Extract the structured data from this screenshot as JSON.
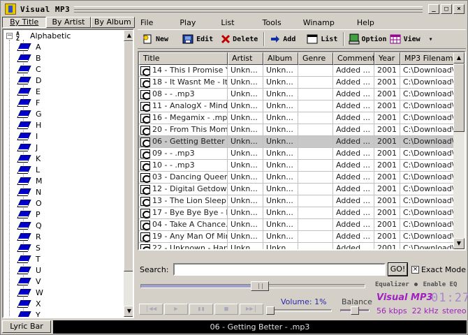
{
  "window": {
    "title": "Visual MP3",
    "min_glyph": "_",
    "max_glyph": "□",
    "close_glyph": "×"
  },
  "browse_tabs": [
    {
      "label": "By Title",
      "active": true
    },
    {
      "label": "By Artist",
      "active": false
    },
    {
      "label": "By Album",
      "active": false
    }
  ],
  "tree": {
    "root_label": "Alphabetic",
    "expander": "−",
    "letters": [
      "A",
      "B",
      "C",
      "D",
      "E",
      "F",
      "G",
      "H",
      "I",
      "J",
      "K",
      "L",
      "M",
      "N",
      "O",
      "P",
      "Q",
      "R",
      "S",
      "T",
      "U",
      "V",
      "W",
      "X",
      "Y"
    ]
  },
  "menu": [
    "File",
    "Play",
    "List",
    "Tools",
    "Winamp",
    "Help"
  ],
  "toolbar": {
    "new": "New",
    "edit": "Edit",
    "delete": "Delete",
    "add": "Add",
    "list": "List",
    "option": "Option",
    "view": "View",
    "dropdown": "▾"
  },
  "grid": {
    "columns": [
      "Title",
      "Artist",
      "Album",
      "Genre",
      "Comment",
      "Year",
      "MP3 Filename"
    ],
    "rows": [
      {
        "title": "14 - This I Promise Y...",
        "artist": "Unkn...",
        "album": "Unkn...",
        "genre": "",
        "comment": "Added ...",
        "year": "2001",
        "file": "C:\\Download\\"
      },
      {
        "title": "18 - It Wasnt Me - It ...",
        "artist": "Unkn...",
        "album": "Unkn...",
        "genre": "",
        "comment": "Added ...",
        "year": "2001",
        "file": "C:\\Download\\"
      },
      {
        "title": "08 - - .mp3",
        "artist": "Unkn...",
        "album": "Unkn...",
        "genre": "",
        "comment": "Added ...",
        "year": "2001",
        "file": "C:\\Download\\"
      },
      {
        "title": "11 - AnalogX - Mind...",
        "artist": "Unkn...",
        "album": "Unkn...",
        "genre": "",
        "comment": "Added ...",
        "year": "2001",
        "file": "C:\\Download\\"
      },
      {
        "title": "16 - Megamix - .mp3",
        "artist": "Unkn...",
        "album": "Unkn...",
        "genre": "",
        "comment": "Added ...",
        "year": "2001",
        "file": "C:\\Download\\"
      },
      {
        "title": "20 - From This Mom...",
        "artist": "Unkn...",
        "album": "Unkn...",
        "genre": "",
        "comment": "Added ...",
        "year": "2001",
        "file": "C:\\Download\\"
      },
      {
        "title": "06 - Getting Better - ...",
        "artist": "Unkn...",
        "album": "Unkn...",
        "genre": "",
        "comment": "Added ...",
        "year": "2001",
        "file": "C:\\Download\\",
        "selected": true
      },
      {
        "title": "09 - - .mp3",
        "artist": "Unkn...",
        "album": "Unkn...",
        "genre": "",
        "comment": "Added ...",
        "year": "2001",
        "file": "C:\\Download\\"
      },
      {
        "title": "10 - - .mp3",
        "artist": "Unkn...",
        "album": "Unkn...",
        "genre": "",
        "comment": "Added ...",
        "year": "2001",
        "file": "C:\\Download\\"
      },
      {
        "title": "03 - Dancing Queen...",
        "artist": "Unkn...",
        "album": "Unkn...",
        "genre": "",
        "comment": "Added ...",
        "year": "2001",
        "file": "C:\\Download\\"
      },
      {
        "title": "12 - Digital Getdown...",
        "artist": "Unkn...",
        "album": "Unkn...",
        "genre": "",
        "comment": "Added ...",
        "year": "2001",
        "file": "C:\\Download\\"
      },
      {
        "title": "13 - The Lion Sleep...",
        "artist": "Unkn...",
        "album": "Unkn...",
        "genre": "",
        "comment": "Added ...",
        "year": "2001",
        "file": "C:\\Download\\"
      },
      {
        "title": "17 - Bye Bye Bye - B...",
        "artist": "Unkn...",
        "album": "Unkn...",
        "genre": "",
        "comment": "Added ...",
        "year": "2001",
        "file": "C:\\Download\\"
      },
      {
        "title": "04 - Take A Chance...",
        "artist": "Unkn...",
        "album": "Unkn...",
        "genre": "",
        "comment": "Added ...",
        "year": "2001",
        "file": "C:\\Download\\"
      },
      {
        "title": "19 - Any Man Of Min...",
        "artist": "Unkn...",
        "album": "Unkn...",
        "genre": "",
        "comment": "Added ...",
        "year": "2001",
        "file": "C:\\Download\\"
      },
      {
        "title": "22 - Unknown - Hap...",
        "artist": "Unkn...",
        "album": "Unkn...",
        "genre": "",
        "comment": "Added ...",
        "year": "2001",
        "file": "C:\\Download\\"
      }
    ]
  },
  "search": {
    "label": "Search:",
    "value": "",
    "go": "GO!",
    "exact_mode_label": "Exact Mode",
    "exact_mode_checked": true,
    "check_glyph": "×"
  },
  "player": {
    "seek_position_pct": 53,
    "equalizer_label": "Equalizer",
    "enable_eq_label": "Enable EQ",
    "brand": "Visual MP3",
    "time": "01:27",
    "bitrate": "56 kbps",
    "samplerate": "22 kHz",
    "mode": "stereo",
    "volume_label": "Volume: 1%",
    "volume_pct": 1,
    "balance_label": "Balance",
    "balance_pct": 50,
    "controls": [
      "|◀◀",
      "▶",
      "▮▮",
      "■",
      "▶▶|"
    ]
  },
  "lyric_bar_label": "Lyric Bar",
  "now_playing": "06 - Getting Better - .mp3",
  "colors": {
    "accent": "#a020c0",
    "volume": "#2828a8",
    "selected_row": "#c8c8c8"
  }
}
